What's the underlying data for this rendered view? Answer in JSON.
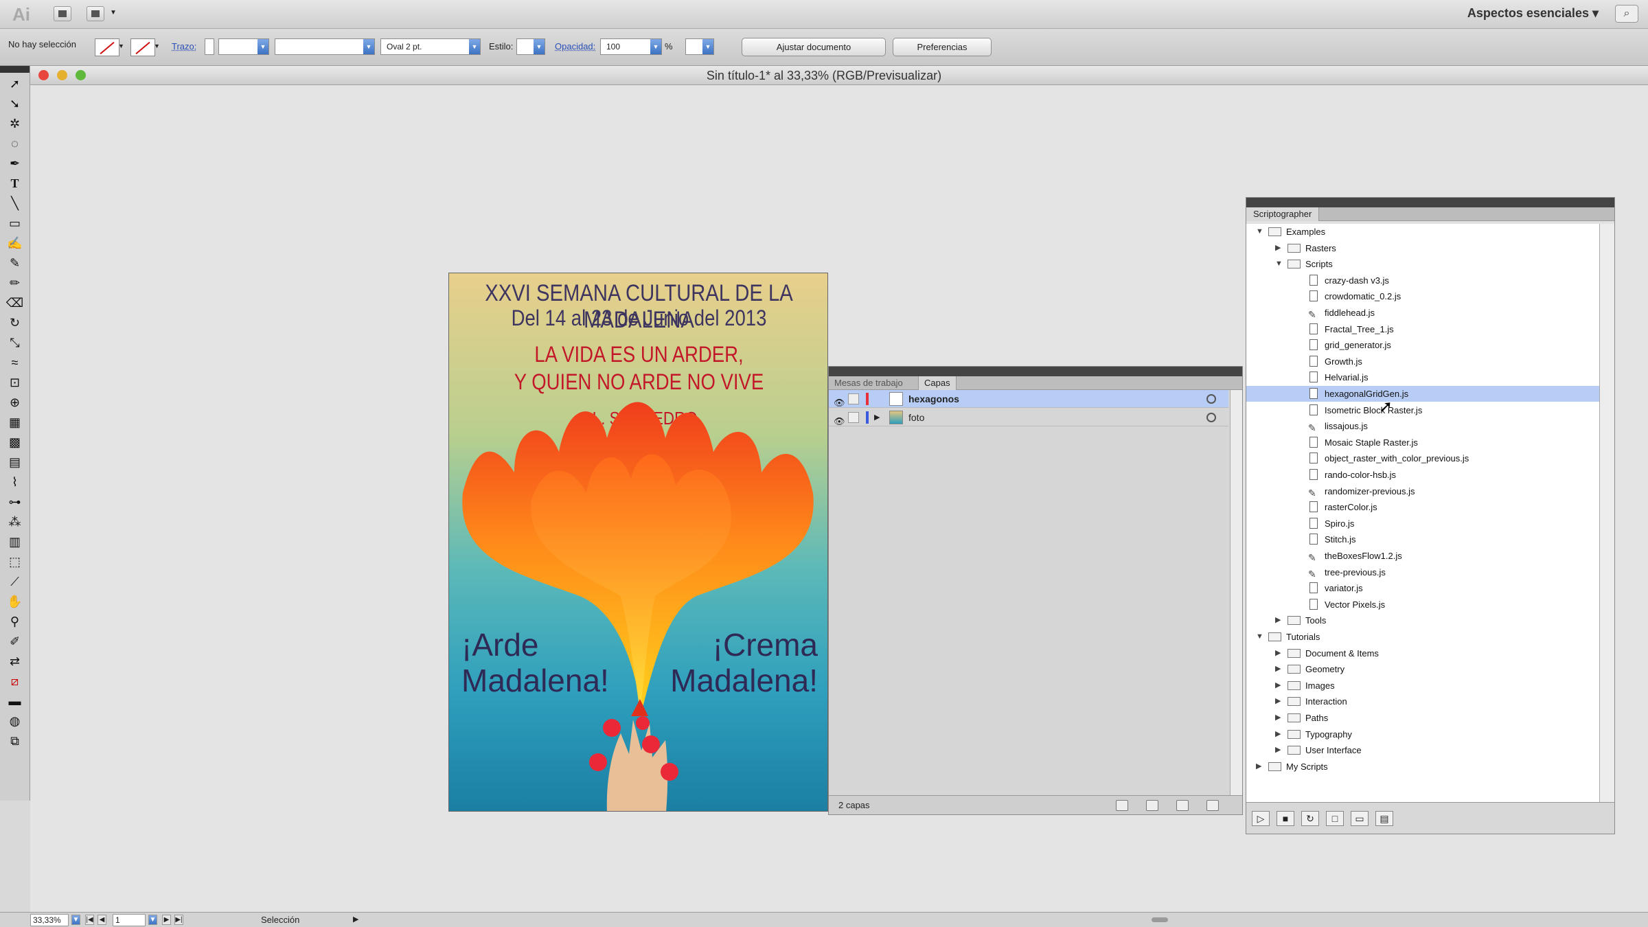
{
  "app": {
    "logo": "Ai",
    "workspace": "Aspectos esenciales ▾",
    "search_icon": "⌕"
  },
  "control_bar": {
    "selection_status": "No hay selección",
    "stroke_label": "Trazo:",
    "brush_value": "Oval 2 pt.",
    "style_label": "Estilo:",
    "opacity_label": "Opacidad:",
    "opacity_value": "100",
    "percent": "%",
    "doc_setup_button": "Ajustar documento",
    "prefs_button": "Preferencias"
  },
  "document": {
    "title": "Sin título-1* al 33,33% (RGB/Previsualizar)"
  },
  "poster": {
    "line1": "XXVI SEMANA CULTURAL DE LA MADALENA",
    "line2": "Del 14 al 23 de Junio del 2013",
    "quote1": "LA VIDA ES UN ARDER,",
    "quote2": "Y QUIEN NO ARDE NO VIVE",
    "author": "J.L. SAMPEDRO",
    "left_slogan": "¡Arde Madalena!",
    "right_slogan": "¡Crema Madalena!",
    "colors": {
      "title": "#3d3560",
      "quote": "#c2182a",
      "flame_outer": "#f03c1c",
      "flame_inner": "#ffd21c"
    }
  },
  "layers_panel": {
    "tabs": [
      "Mesas de trabajo",
      "Capas"
    ],
    "layers": [
      {
        "name": "hexagonos",
        "color": "#e8303a",
        "selected": true
      },
      {
        "name": "foto",
        "color": "#3a5ae0",
        "selected": false
      }
    ],
    "footer": "2 capas"
  },
  "scriptographer": {
    "title": "Scriptographer",
    "tree": [
      {
        "label": "Examples",
        "type": "folder",
        "depth": 0,
        "open": true
      },
      {
        "label": "Rasters",
        "type": "folder",
        "depth": 1,
        "open": false
      },
      {
        "label": "Scripts",
        "type": "folder",
        "depth": 1,
        "open": true
      },
      {
        "label": "crazy-dash v3.js",
        "type": "file",
        "depth": 2
      },
      {
        "label": "crowdomatic_0.2.js",
        "type": "file",
        "depth": 2
      },
      {
        "label": "fiddlehead.js",
        "type": "tool",
        "depth": 2
      },
      {
        "label": "Fractal_Tree_1.js",
        "type": "file",
        "depth": 2
      },
      {
        "label": "grid_generator.js",
        "type": "file",
        "depth": 2
      },
      {
        "label": "Growth.js",
        "type": "file",
        "depth": 2
      },
      {
        "label": "Helvarial.js",
        "type": "file",
        "depth": 2
      },
      {
        "label": "hexagonalGridGen.js",
        "type": "file",
        "depth": 2,
        "selected": true
      },
      {
        "label": "Isometric Block Raster.js",
        "type": "file",
        "depth": 2
      },
      {
        "label": "lissajous.js",
        "type": "tool",
        "depth": 2
      },
      {
        "label": "Mosaic Staple Raster.js",
        "type": "file",
        "depth": 2
      },
      {
        "label": "object_raster_with_color_previous.js",
        "type": "file",
        "depth": 2
      },
      {
        "label": "rando-color-hsb.js",
        "type": "file",
        "depth": 2
      },
      {
        "label": "randomizer-previous.js",
        "type": "tool",
        "depth": 2
      },
      {
        "label": "rasterColor.js",
        "type": "file",
        "depth": 2
      },
      {
        "label": "Spiro.js",
        "type": "file",
        "depth": 2
      },
      {
        "label": "Stitch.js",
        "type": "file",
        "depth": 2
      },
      {
        "label": "theBoxesFlow1.2.js",
        "type": "tool",
        "depth": 2
      },
      {
        "label": "tree-previous.js",
        "type": "tool",
        "depth": 2
      },
      {
        "label": "variator.js",
        "type": "file",
        "depth": 2
      },
      {
        "label": "Vector Pixels.js",
        "type": "file",
        "depth": 2
      },
      {
        "label": "Tools",
        "type": "folder",
        "depth": 1,
        "open": false
      },
      {
        "label": "Tutorials",
        "type": "folder",
        "depth": 0,
        "open": true
      },
      {
        "label": "Document & Items",
        "type": "folder",
        "depth": 1,
        "open": false
      },
      {
        "label": "Geometry",
        "type": "folder",
        "depth": 1,
        "open": false
      },
      {
        "label": "Images",
        "type": "folder",
        "depth": 1,
        "open": false
      },
      {
        "label": "Interaction",
        "type": "folder",
        "depth": 1,
        "open": false
      },
      {
        "label": "Paths",
        "type": "folder",
        "depth": 1,
        "open": false
      },
      {
        "label": "Typography",
        "type": "folder",
        "depth": 1,
        "open": false
      },
      {
        "label": "User Interface",
        "type": "folder",
        "depth": 1,
        "open": false
      },
      {
        "label": "My Scripts",
        "type": "folder",
        "depth": 0,
        "open": false
      }
    ],
    "selection_color": "#b7cdf5"
  },
  "status_bar": {
    "zoom": "33,33%",
    "artboard": "1",
    "tool": "Selección"
  }
}
